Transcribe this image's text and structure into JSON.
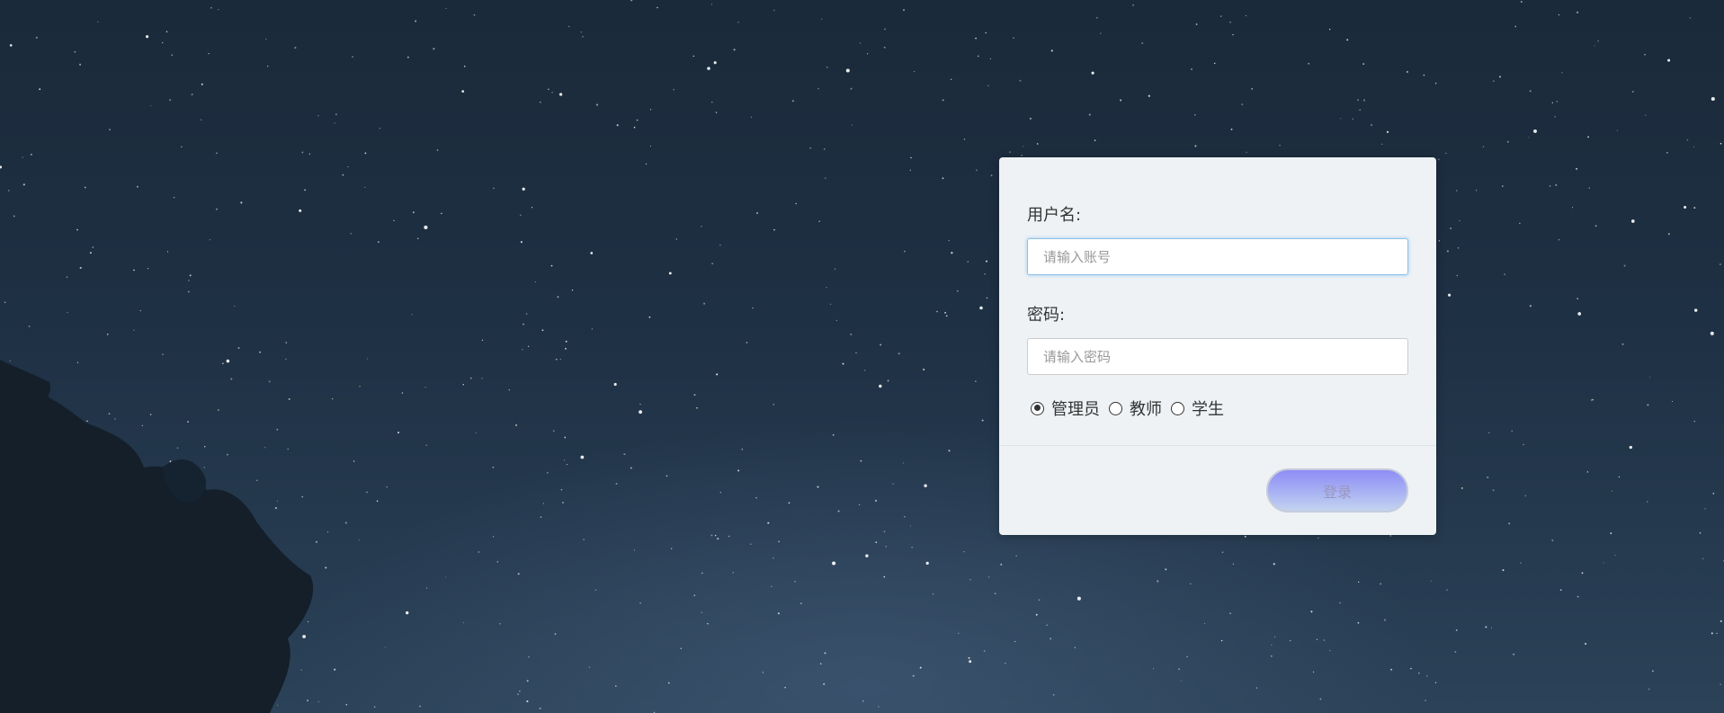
{
  "login_form": {
    "username_label": "用户名:",
    "username_placeholder": "请输入账号",
    "username_value": "",
    "password_label": "密码:",
    "password_placeholder": "请输入密码",
    "password_value": "",
    "roles": [
      {
        "label": "管理员",
        "checked": true
      },
      {
        "label": "教师",
        "checked": false
      },
      {
        "label": "学生",
        "checked": false
      }
    ],
    "login_label": "登录"
  },
  "colors": {
    "panel_background": "#eef2f5",
    "button_gradient_top": "#8f8cf6",
    "button_gradient_bottom": "#c3d3ef",
    "sky_background": "#1e3044"
  }
}
